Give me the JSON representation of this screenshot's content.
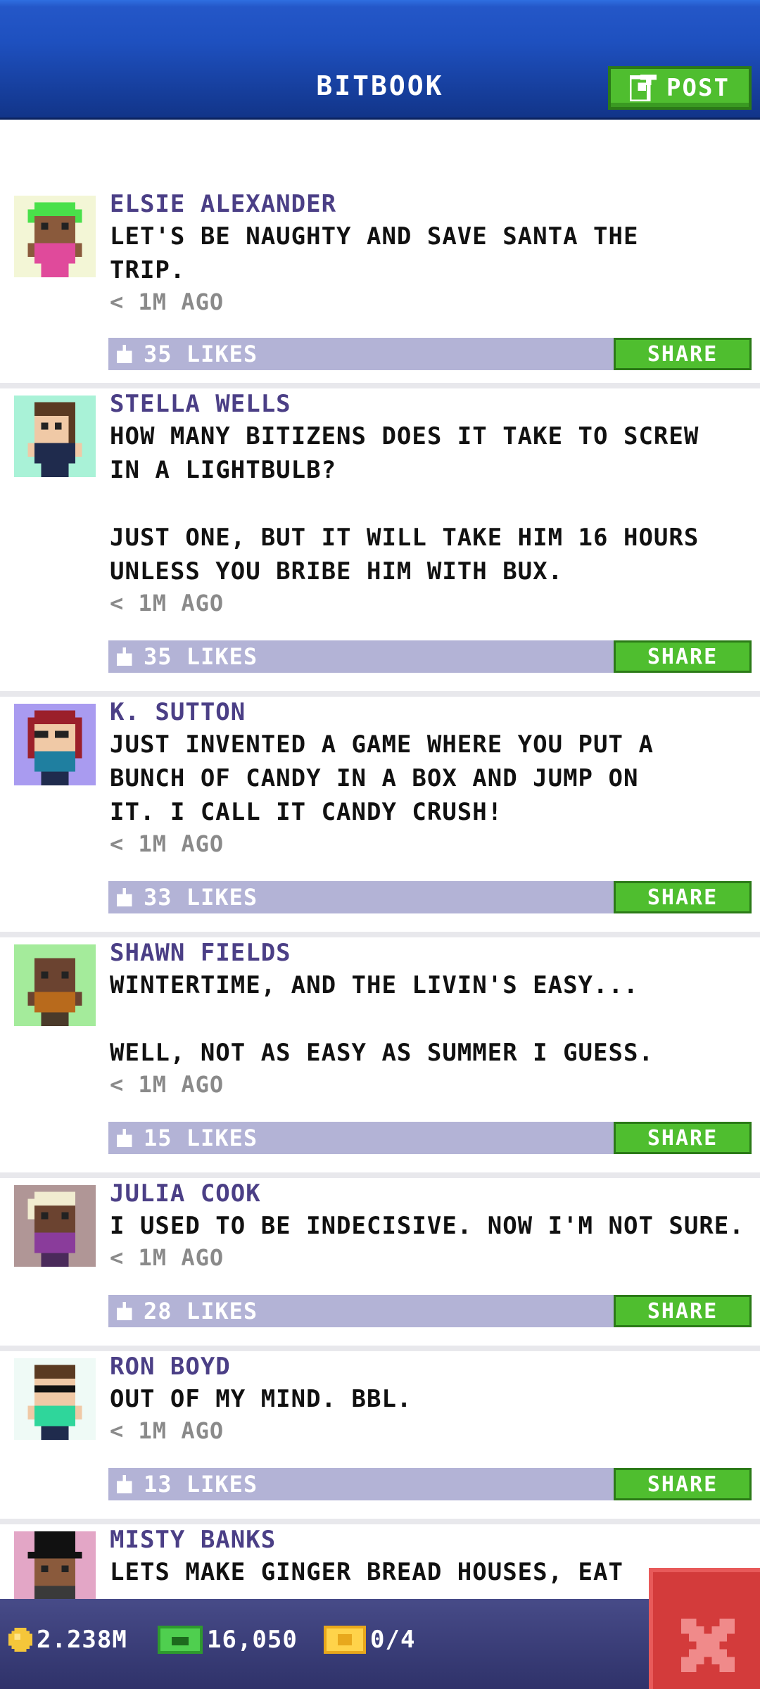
{
  "header": {
    "title": "BITBOOK",
    "post_label": "POST"
  },
  "colors": {
    "header_blue": "#1e50bf",
    "name_purple": "#4b3f86",
    "likes_bar": "#b3b3d6",
    "share_green": "#4fbe2f",
    "close_red": "#d33b3b",
    "footer_navy": "#3a3d78"
  },
  "posts": [
    {
      "name": "ELSIE ALEXANDER",
      "text": "LET'S BE NAUGHTY AND SAVE SANTA THE\nTRIP.",
      "time": "< 1M AGO",
      "likes": "35 LIKES",
      "share": "SHARE",
      "avatar_icon": "bitizen-avatar-green-hair"
    },
    {
      "name": "STELLA WELLS",
      "text": "HOW MANY BITIZENS DOES IT TAKE TO SCREW\nIN A LIGHTBULB?\n\nJUST ONE, BUT IT WILL TAKE HIM 16 HOURS\nUNLESS YOU BRIBE HIM WITH BUX.",
      "time": "< 1M AGO",
      "likes": "35 LIKES",
      "share": "SHARE",
      "avatar_icon": "bitizen-avatar-brown-hair"
    },
    {
      "name": "K. SUTTON",
      "text": "JUST INVENTED A GAME WHERE YOU PUT A\nBUNCH OF CANDY IN A BOX AND JUMP ON\nIT. I CALL IT CANDY CRUSH!",
      "time": "< 1M AGO",
      "likes": "33 LIKES",
      "share": "SHARE",
      "avatar_icon": "bitizen-avatar-red-hair-glasses"
    },
    {
      "name": "SHAWN FIELDS",
      "text": "WINTERTIME, AND THE LIVIN'S EASY...\n\nWELL, NOT AS EASY AS SUMMER I GUESS.",
      "time": "< 1M AGO",
      "likes": "15 LIKES",
      "share": "SHARE",
      "avatar_icon": "bitizen-avatar-bald"
    },
    {
      "name": "JULIA COOK",
      "text": "I USED TO BE INDECISIVE. NOW I'M NOT SURE.",
      "time": "< 1M AGO",
      "likes": "28 LIKES",
      "share": "SHARE",
      "avatar_icon": "bitizen-avatar-blonde"
    },
    {
      "name": "RON BOYD",
      "text": "OUT OF MY MIND. BBL.",
      "time": "< 1M AGO",
      "likes": "13 LIKES",
      "share": "SHARE",
      "avatar_icon": "bitizen-avatar-sunglasses"
    },
    {
      "name": "MISTY BANKS",
      "text": "LETS MAKE GINGER BREAD HOUSES, EAT",
      "time": "",
      "likes": "",
      "share": "",
      "avatar_icon": "bitizen-avatar-top-hat"
    }
  ],
  "footer": {
    "coins": "2.238M",
    "bux": "16,050",
    "tickets": "0/4"
  }
}
